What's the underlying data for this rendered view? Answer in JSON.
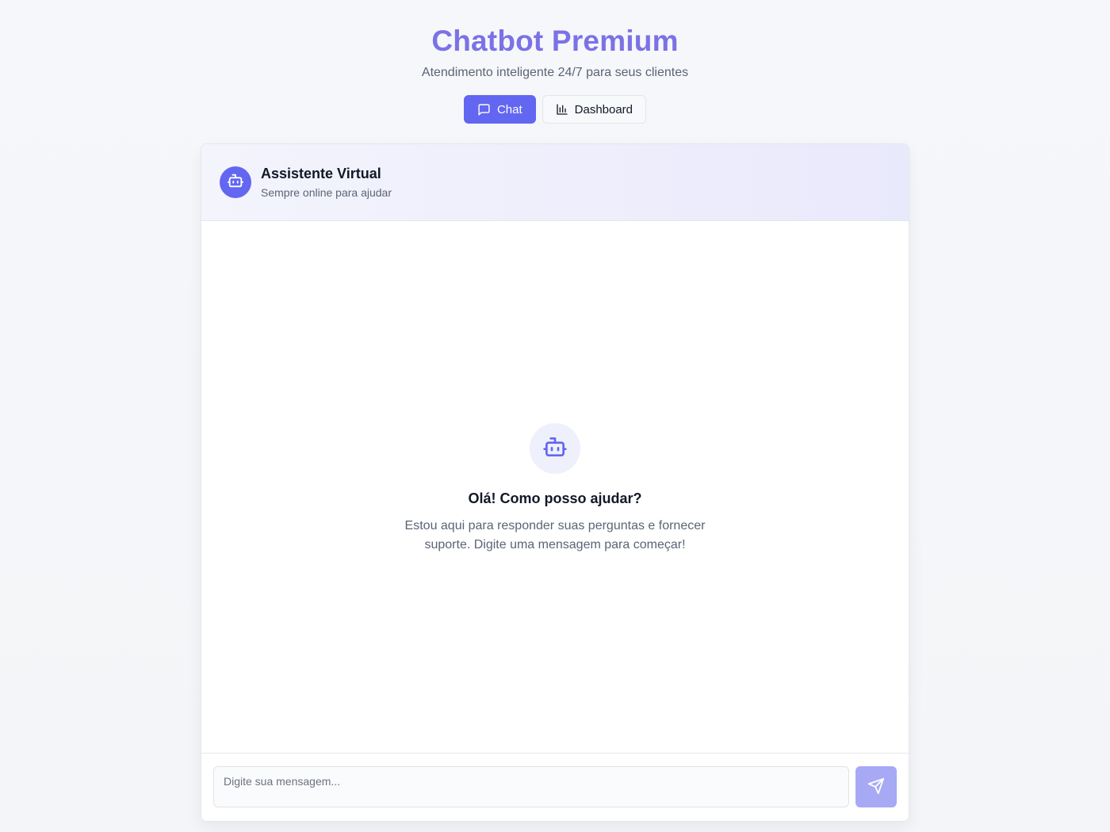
{
  "header": {
    "title": "Chatbot Premium",
    "subtitle": "Atendimento inteligente 24/7 para seus clientes"
  },
  "nav": {
    "chat_label": "Chat",
    "chat_icon": "message-square-icon",
    "dashboard_label": "Dashboard",
    "dashboard_icon": "bar-chart-icon",
    "active_tab": "Chat"
  },
  "assistant": {
    "name": "Assistente Virtual",
    "status": "Sempre online para ajudar",
    "avatar_icon": "bot-icon"
  },
  "empty_state": {
    "icon": "bot-icon",
    "title": "Olá! Como posso ajudar?",
    "description": "Estou aqui para responder suas perguntas e fornecer suporte. Digite uma mensagem para começar!"
  },
  "composer": {
    "placeholder": "Digite sua mensagem...",
    "value": "",
    "send_icon": "send-icon"
  },
  "colors": {
    "accent": "#6366f1",
    "title": "#7b72e6",
    "send_disabled": "#a7a9f5"
  }
}
